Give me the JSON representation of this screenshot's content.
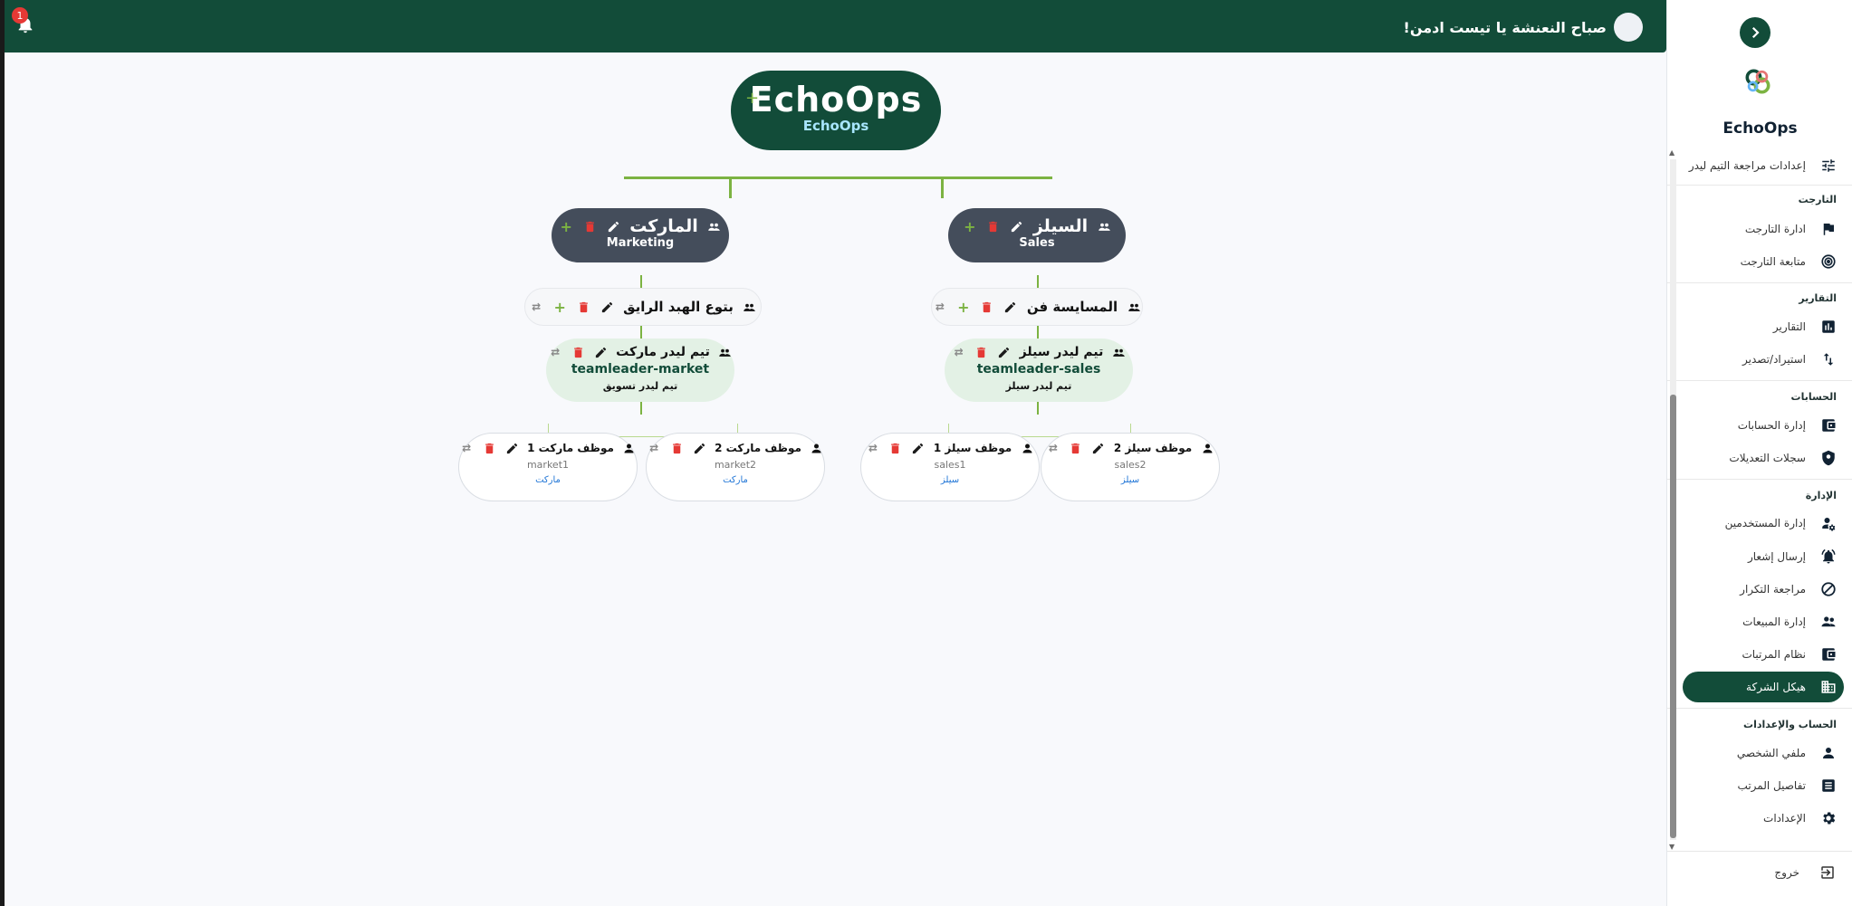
{
  "header": {
    "greeting": "صباح النعنشة يا تيست ادمن!",
    "notification_count": "1"
  },
  "sidebar": {
    "brand": "EchoOps",
    "top_item": "إعدادات مراجعة التيم ليدر",
    "sections": {
      "target": "التارجت",
      "reports": "التقارير",
      "accounts": "الحسابات",
      "admin": "الإدارة",
      "account_settings": "الحساب والإعدادات"
    },
    "items": {
      "manage_target": "ادارة التارجت",
      "track_target": "متابعة التارجت",
      "reports": "التقارير",
      "import_export": "استيراد/تصدير",
      "manage_accounts": "إدارة الحسابات",
      "change_logs": "سجلات التعديلات",
      "manage_users": "إدارة المستخدمين",
      "send_notification": "إرسال إشعار",
      "review_duplicates": "مراجعة التكرار",
      "manage_sales": "إدارة المبيعات",
      "salary_system": "نظام المرتبات",
      "company_structure": "هيكل الشركة",
      "profile": "ملفي الشخصي",
      "salary_details": "تفاصيل المرتب",
      "settings": "الإعدادات"
    },
    "logout": "خروج"
  },
  "org": {
    "root": {
      "title": "EchoOps",
      "subtitle": "EchoOps"
    },
    "depts": [
      {
        "name": "السيلز",
        "sub": "Sales",
        "team": "المسايسة فن",
        "lead": {
          "name": "تيم ليدر سيلز",
          "user": "teamleader-sales",
          "role": "تيم ليدر سيلز"
        },
        "employees": [
          {
            "name": "موظف سيلز 1",
            "user": "sales1",
            "role": "سيلز"
          },
          {
            "name": "موظف سيلز 2",
            "user": "sales2",
            "role": "سيلز"
          }
        ]
      },
      {
        "name": "الماركت",
        "sub": "Marketing",
        "team": "بتوع الهبد الرايق",
        "lead": {
          "name": "تيم ليدر ماركت",
          "user": "teamleader-market",
          "role": "تيم ليدر تسويق"
        },
        "employees": [
          {
            "name": "موظف ماركت 1",
            "user": "market1",
            "role": "ماركت"
          },
          {
            "name": "موظف ماركت 2",
            "user": "market2",
            "role": "ماركت"
          }
        ]
      }
    ]
  },
  "colors": {
    "primary": "#124c39",
    "accent": "#7cb342",
    "dept": "#444d5b",
    "lead_bg": "#e3f1e5",
    "danger": "#e53935",
    "role": "#1e74d6"
  },
  "icons": [
    "bell-icon",
    "chevron-right-icon",
    "logo-icon",
    "sliders-icon",
    "flag-icon",
    "target-icon",
    "bar-chart-icon",
    "sort-icon",
    "wallet-icon",
    "shield-icon",
    "user-gear-icon",
    "bell-alert-icon",
    "ban-icon",
    "users-icon",
    "building-icon",
    "person-icon",
    "list-icon",
    "gear-icon",
    "logout-icon",
    "group-icon",
    "edit-icon",
    "delete-icon",
    "add-icon",
    "move-icon"
  ]
}
